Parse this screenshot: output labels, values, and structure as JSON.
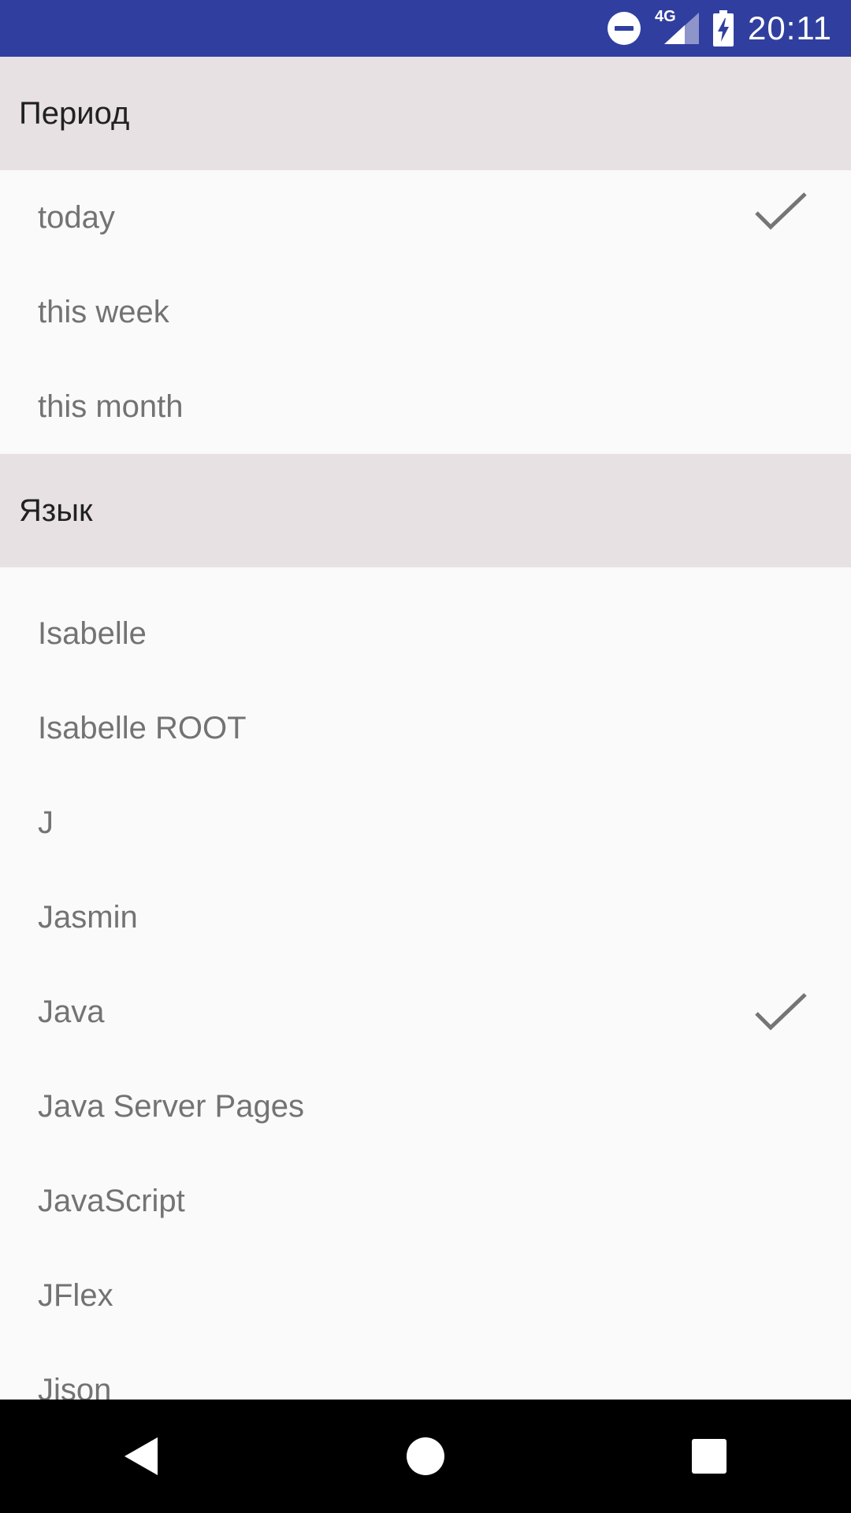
{
  "status_bar": {
    "network": "4G",
    "time": "20:11"
  },
  "sections": {
    "period": {
      "title": "Период",
      "items": [
        "today",
        "this week",
        "this month"
      ],
      "selected": "today"
    },
    "language": {
      "title": "Язык",
      "items": [
        "Isabelle",
        "Isabelle ROOT",
        "J",
        "Jasmin",
        "Java",
        "Java Server Pages",
        "JavaScript",
        "JFlex",
        "Jison"
      ],
      "selected": "Java"
    }
  },
  "icons": {
    "check": "check-icon",
    "back": "back-icon",
    "home": "home-icon",
    "recents": "recents-icon"
  },
  "colors": {
    "status_bar": "#303f9f",
    "section_header": "#e7e1e3",
    "background": "#fafafa",
    "item_text": "#737373",
    "check": "#757575"
  }
}
